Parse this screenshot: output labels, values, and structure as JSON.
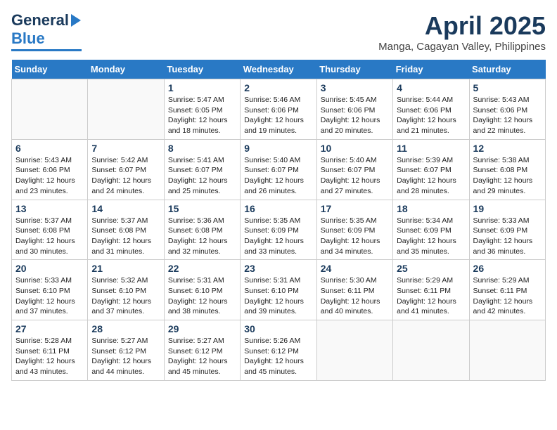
{
  "header": {
    "logo_line1": "General",
    "logo_line2": "Blue",
    "main_title": "April 2025",
    "subtitle": "Manga, Cagayan Valley, Philippines"
  },
  "days_of_week": [
    "Sunday",
    "Monday",
    "Tuesday",
    "Wednesday",
    "Thursday",
    "Friday",
    "Saturday"
  ],
  "weeks": [
    [
      {
        "day": "",
        "info": ""
      },
      {
        "day": "",
        "info": ""
      },
      {
        "day": "1",
        "info": "Sunrise: 5:47 AM\nSunset: 6:05 PM\nDaylight: 12 hours and 18 minutes."
      },
      {
        "day": "2",
        "info": "Sunrise: 5:46 AM\nSunset: 6:06 PM\nDaylight: 12 hours and 19 minutes."
      },
      {
        "day": "3",
        "info": "Sunrise: 5:45 AM\nSunset: 6:06 PM\nDaylight: 12 hours and 20 minutes."
      },
      {
        "day": "4",
        "info": "Sunrise: 5:44 AM\nSunset: 6:06 PM\nDaylight: 12 hours and 21 minutes."
      },
      {
        "day": "5",
        "info": "Sunrise: 5:43 AM\nSunset: 6:06 PM\nDaylight: 12 hours and 22 minutes."
      }
    ],
    [
      {
        "day": "6",
        "info": "Sunrise: 5:43 AM\nSunset: 6:06 PM\nDaylight: 12 hours and 23 minutes."
      },
      {
        "day": "7",
        "info": "Sunrise: 5:42 AM\nSunset: 6:07 PM\nDaylight: 12 hours and 24 minutes."
      },
      {
        "day": "8",
        "info": "Sunrise: 5:41 AM\nSunset: 6:07 PM\nDaylight: 12 hours and 25 minutes."
      },
      {
        "day": "9",
        "info": "Sunrise: 5:40 AM\nSunset: 6:07 PM\nDaylight: 12 hours and 26 minutes."
      },
      {
        "day": "10",
        "info": "Sunrise: 5:40 AM\nSunset: 6:07 PM\nDaylight: 12 hours and 27 minutes."
      },
      {
        "day": "11",
        "info": "Sunrise: 5:39 AM\nSunset: 6:07 PM\nDaylight: 12 hours and 28 minutes."
      },
      {
        "day": "12",
        "info": "Sunrise: 5:38 AM\nSunset: 6:08 PM\nDaylight: 12 hours and 29 minutes."
      }
    ],
    [
      {
        "day": "13",
        "info": "Sunrise: 5:37 AM\nSunset: 6:08 PM\nDaylight: 12 hours and 30 minutes."
      },
      {
        "day": "14",
        "info": "Sunrise: 5:37 AM\nSunset: 6:08 PM\nDaylight: 12 hours and 31 minutes."
      },
      {
        "day": "15",
        "info": "Sunrise: 5:36 AM\nSunset: 6:08 PM\nDaylight: 12 hours and 32 minutes."
      },
      {
        "day": "16",
        "info": "Sunrise: 5:35 AM\nSunset: 6:09 PM\nDaylight: 12 hours and 33 minutes."
      },
      {
        "day": "17",
        "info": "Sunrise: 5:35 AM\nSunset: 6:09 PM\nDaylight: 12 hours and 34 minutes."
      },
      {
        "day": "18",
        "info": "Sunrise: 5:34 AM\nSunset: 6:09 PM\nDaylight: 12 hours and 35 minutes."
      },
      {
        "day": "19",
        "info": "Sunrise: 5:33 AM\nSunset: 6:09 PM\nDaylight: 12 hours and 36 minutes."
      }
    ],
    [
      {
        "day": "20",
        "info": "Sunrise: 5:33 AM\nSunset: 6:10 PM\nDaylight: 12 hours and 37 minutes."
      },
      {
        "day": "21",
        "info": "Sunrise: 5:32 AM\nSunset: 6:10 PM\nDaylight: 12 hours and 37 minutes."
      },
      {
        "day": "22",
        "info": "Sunrise: 5:31 AM\nSunset: 6:10 PM\nDaylight: 12 hours and 38 minutes."
      },
      {
        "day": "23",
        "info": "Sunrise: 5:31 AM\nSunset: 6:10 PM\nDaylight: 12 hours and 39 minutes."
      },
      {
        "day": "24",
        "info": "Sunrise: 5:30 AM\nSunset: 6:11 PM\nDaylight: 12 hours and 40 minutes."
      },
      {
        "day": "25",
        "info": "Sunrise: 5:29 AM\nSunset: 6:11 PM\nDaylight: 12 hours and 41 minutes."
      },
      {
        "day": "26",
        "info": "Sunrise: 5:29 AM\nSunset: 6:11 PM\nDaylight: 12 hours and 42 minutes."
      }
    ],
    [
      {
        "day": "27",
        "info": "Sunrise: 5:28 AM\nSunset: 6:11 PM\nDaylight: 12 hours and 43 minutes."
      },
      {
        "day": "28",
        "info": "Sunrise: 5:27 AM\nSunset: 6:12 PM\nDaylight: 12 hours and 44 minutes."
      },
      {
        "day": "29",
        "info": "Sunrise: 5:27 AM\nSunset: 6:12 PM\nDaylight: 12 hours and 45 minutes."
      },
      {
        "day": "30",
        "info": "Sunrise: 5:26 AM\nSunset: 6:12 PM\nDaylight: 12 hours and 45 minutes."
      },
      {
        "day": "",
        "info": ""
      },
      {
        "day": "",
        "info": ""
      },
      {
        "day": "",
        "info": ""
      }
    ]
  ]
}
